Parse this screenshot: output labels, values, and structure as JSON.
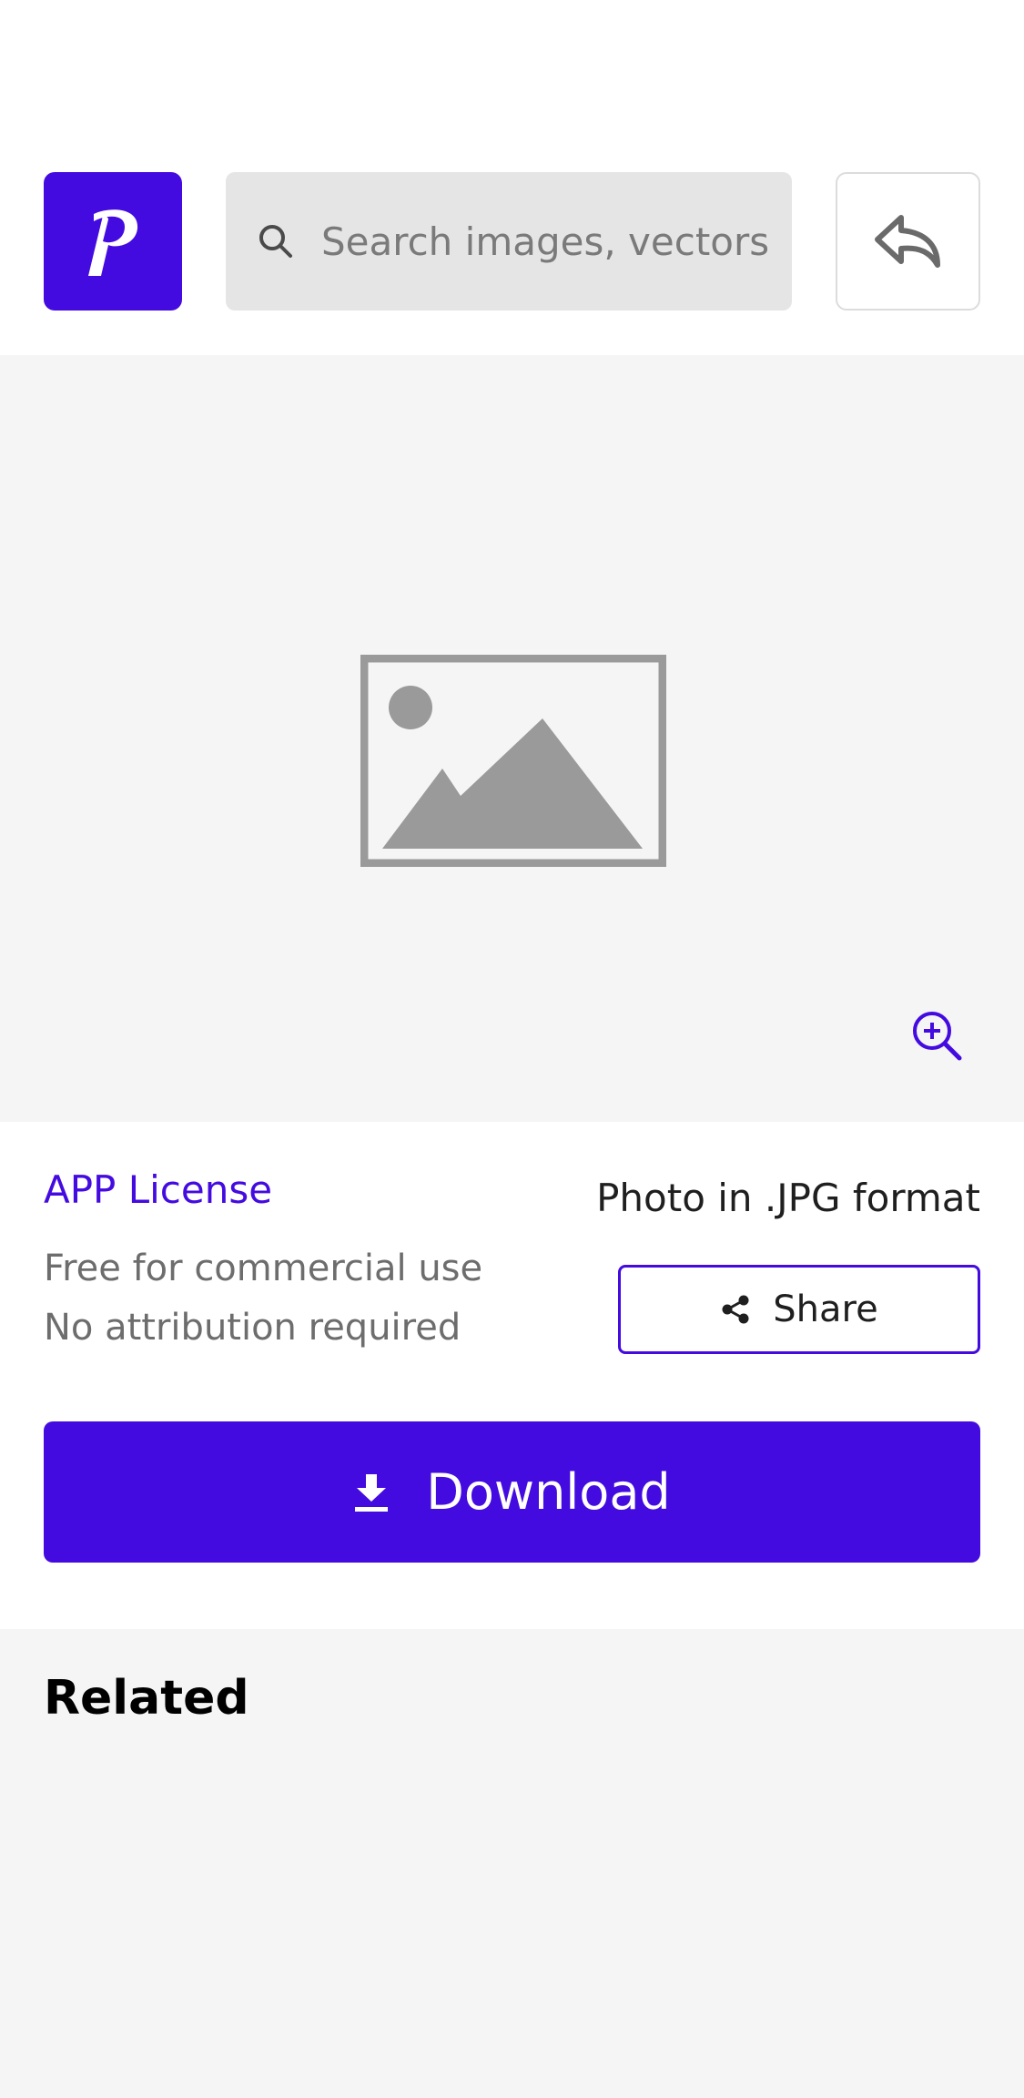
{
  "header": {
    "logo_letter": "P",
    "search_placeholder": "Search images, vectors..."
  },
  "image": {
    "placeholder_icon": "image-placeholder-icon",
    "zoom_icon": "zoom-in-icon"
  },
  "info": {
    "license_label": "APP License",
    "usage_line1": "Free for commercial use",
    "usage_line2": "No attribution required",
    "format_label": "Photo in .JPG format",
    "share_label": "Share",
    "download_label": "Download"
  },
  "related": {
    "title": "Related"
  },
  "colors": {
    "brand": "#440be0",
    "image_bg": "#f5f5f5",
    "search_bg": "#e5e5e5"
  }
}
